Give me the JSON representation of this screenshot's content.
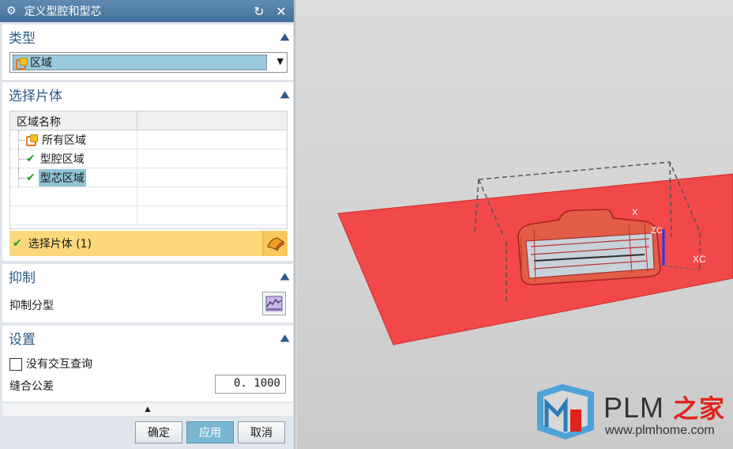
{
  "dialog": {
    "title": "定义型腔和型芯",
    "icons": {
      "gear": "gear-icon",
      "reset": "reset-icon",
      "close": "close-icon"
    }
  },
  "type_section": {
    "title": "类型",
    "selected_value": "区域"
  },
  "select_section": {
    "title": "选择片体",
    "column_header": "区域名称",
    "rows": [
      {
        "label": "所有区域",
        "icon": "region-icon"
      },
      {
        "label": "型腔区域",
        "icon": "check-icon"
      },
      {
        "label": "型芯区域",
        "icon": "check-icon",
        "selected": true
      }
    ],
    "select_label": "选择片体 (1)"
  },
  "suppress_section": {
    "title": "抑制",
    "label": "抑制分型"
  },
  "settings_section": {
    "title": "设置",
    "checkbox_label": "没有交互查询",
    "checkbox_checked": false,
    "tolerance_label": "缝合公差",
    "tolerance_value": "0. 1000"
  },
  "buttons": {
    "ok": "确定",
    "apply": "应用",
    "cancel": "取消"
  },
  "viewport": {
    "axis_labels": {
      "x": "X",
      "xc": "XC",
      "zc": "ZC"
    },
    "colors": {
      "parting_sheet": "#f2484a",
      "part": "#e25c46",
      "accent": "#78b6d3"
    }
  },
  "watermark": {
    "brand": "PLM",
    "brand_cn": "之家",
    "url": "www.plmhome.com"
  }
}
